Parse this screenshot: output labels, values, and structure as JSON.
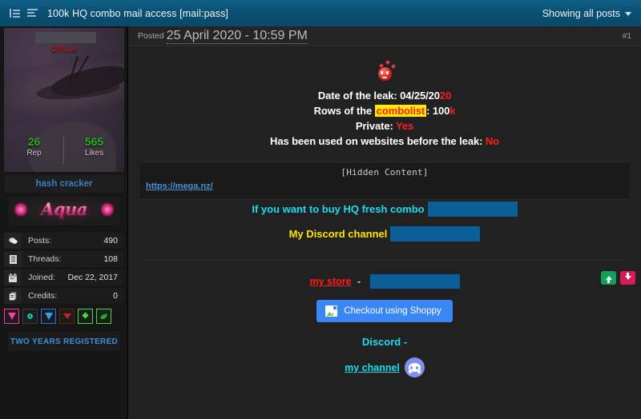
{
  "topbar": {
    "icon_left": "list-view-icon",
    "icon_right": "thread-mode-icon",
    "title": "100k HQ combo mail access [mail:pass]",
    "filter_label": "Showing all posts",
    "caret": "chevron-down-icon",
    "accent": "#0b4f72"
  },
  "sidebar": {
    "status": "Offline",
    "username_redacted": true,
    "stats": [
      {
        "num": "26",
        "label": "Rep"
      },
      {
        "num": "565",
        "label": "Likes"
      }
    ],
    "usertitle": "hash cracker",
    "rank_image_text": "Aqua",
    "minfo": [
      {
        "icon": "speech-bubble-icon",
        "label": "Posts:",
        "value": "490"
      },
      {
        "icon": "document-icon",
        "label": "Threads:",
        "value": "108"
      },
      {
        "icon": "calendar-icon",
        "label": "Joined:",
        "value": "Dec 22, 2017"
      },
      {
        "icon": "credits-icon",
        "label": "Credits:",
        "value": "0"
      }
    ],
    "badges": [
      {
        "name": "pink-gem-badge",
        "cls": "bg-pink"
      },
      {
        "name": "teal-star-badge",
        "cls": "bg-dark"
      },
      {
        "name": "blue-gem-badge",
        "cls": "bg-blue"
      },
      {
        "name": "red-gem-badge",
        "cls": "bg-red"
      },
      {
        "name": "green-puzzle-badge",
        "cls": "bg-grn"
      },
      {
        "name": "green-leaf-badge",
        "cls": "bg-grn"
      }
    ],
    "years_badge": "TWO YEARS REGISTERED",
    "colors": {
      "stat_green": "#26b11f",
      "username_blue": "#3c7ebf",
      "offline_red": "#9e1f1f"
    }
  },
  "post": {
    "posted_prefix": "Posted",
    "posted_date": "25 April 2020 - 10:59 PM",
    "post_number": "#1",
    "emoji": "blushing-hearts-emoji",
    "leak_info": [
      {
        "label": "Date of the leak: 04/25/20",
        "highlight_plain": "20",
        "style": "split-red-tail"
      },
      {
        "label_pre": "Rows of the ",
        "chip": "combolist",
        "label_mid": ": 100",
        "tail": "k",
        "style": "highlight-chip"
      },
      {
        "label_pre": "Private: ",
        "tail": "Yes",
        "style": "red-tail"
      },
      {
        "label_pre": "Has been used on websites before the leak: ",
        "tail": "No",
        "style": "red-tail"
      }
    ],
    "hidden_content_label": "[Hidden Content]",
    "mega_link": "https://mega.nz/",
    "promo": {
      "line1": "If you want to buy HQ fresh combo",
      "line2": "My Discord channel",
      "store_link": "my store",
      "store_dash": "-",
      "shoppy_button": "Checkout using Shoppy",
      "shoppy_icon": "shoppy-logo-icon",
      "discord_label": "Discord -",
      "discord_link": "my channel",
      "discord_icon": "discord-logo-icon"
    },
    "votes": {
      "up": "upvote-arrow-icon",
      "down": "downvote-arrow-icon",
      "up_color": "#10a05a",
      "down_color": "#d81b52"
    },
    "colors": {
      "cyan": "#1edcf0",
      "yellow": "#ffe400",
      "red": "#ff1c1c",
      "redaction": "#0b5f97",
      "shoppy_blue": "#3b86f7"
    }
  }
}
